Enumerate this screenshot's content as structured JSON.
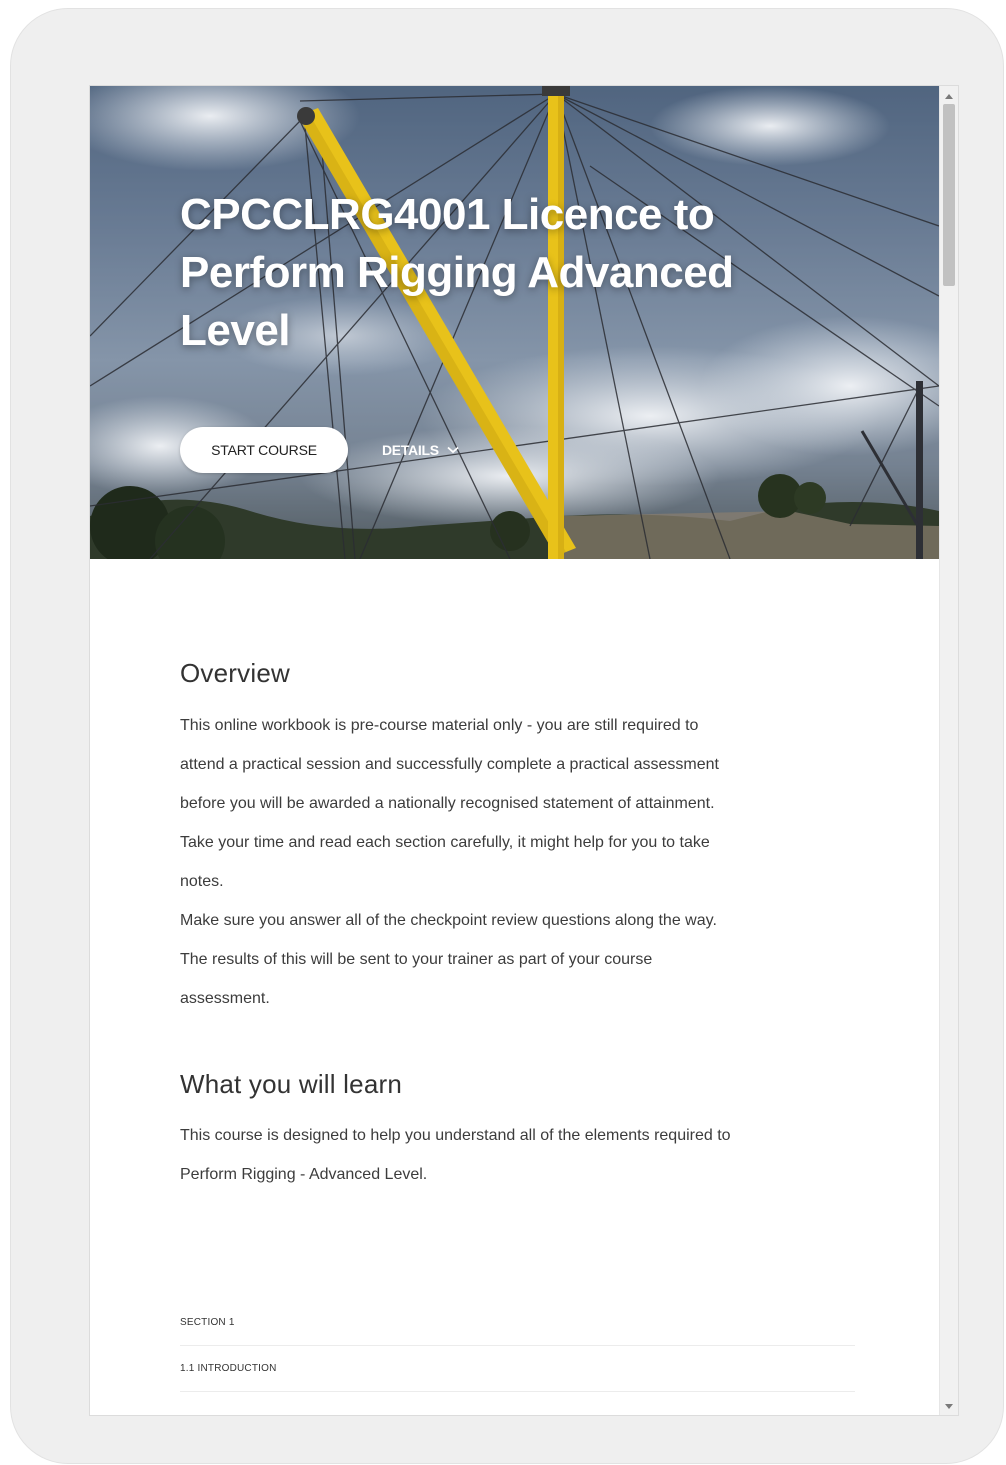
{
  "course": {
    "title": "CPCCLRG4001 Licence to Perform Rigging Advanced Level",
    "start_button": "START COURSE",
    "details_button": "DETAILS"
  },
  "overview": {
    "heading": "Overview",
    "lines": [
      "This online workbook is pre-course material only - you are still required to",
      "attend a practical session and successfully complete a practical assessment",
      "before you will be awarded a nationally recognised statement of attainment.",
      "Take your time and read each section carefully, it might help for you to take",
      "notes.",
      "Make sure you answer all of the checkpoint review questions along the way.",
      "The results of this will be sent to your trainer as part of your course",
      "assessment."
    ]
  },
  "learn": {
    "heading": "What you will learn",
    "lines": [
      "This course is designed to help you understand all of the elements required to",
      "Perform Rigging - Advanced Level."
    ]
  },
  "lessons": [
    {
      "label": "SECTION 1"
    },
    {
      "label": "1.1 INTRODUCTION"
    }
  ],
  "icons": {
    "details": "chevron-down-icon",
    "scroll_up": "scroll-up-arrow-icon",
    "scroll_down": "scroll-down-arrow-icon"
  },
  "colors": {
    "crane": "#e8c21a",
    "button_bg": "#ffffff",
    "heading_text": "#333333",
    "body_text": "#3c3c3c"
  }
}
